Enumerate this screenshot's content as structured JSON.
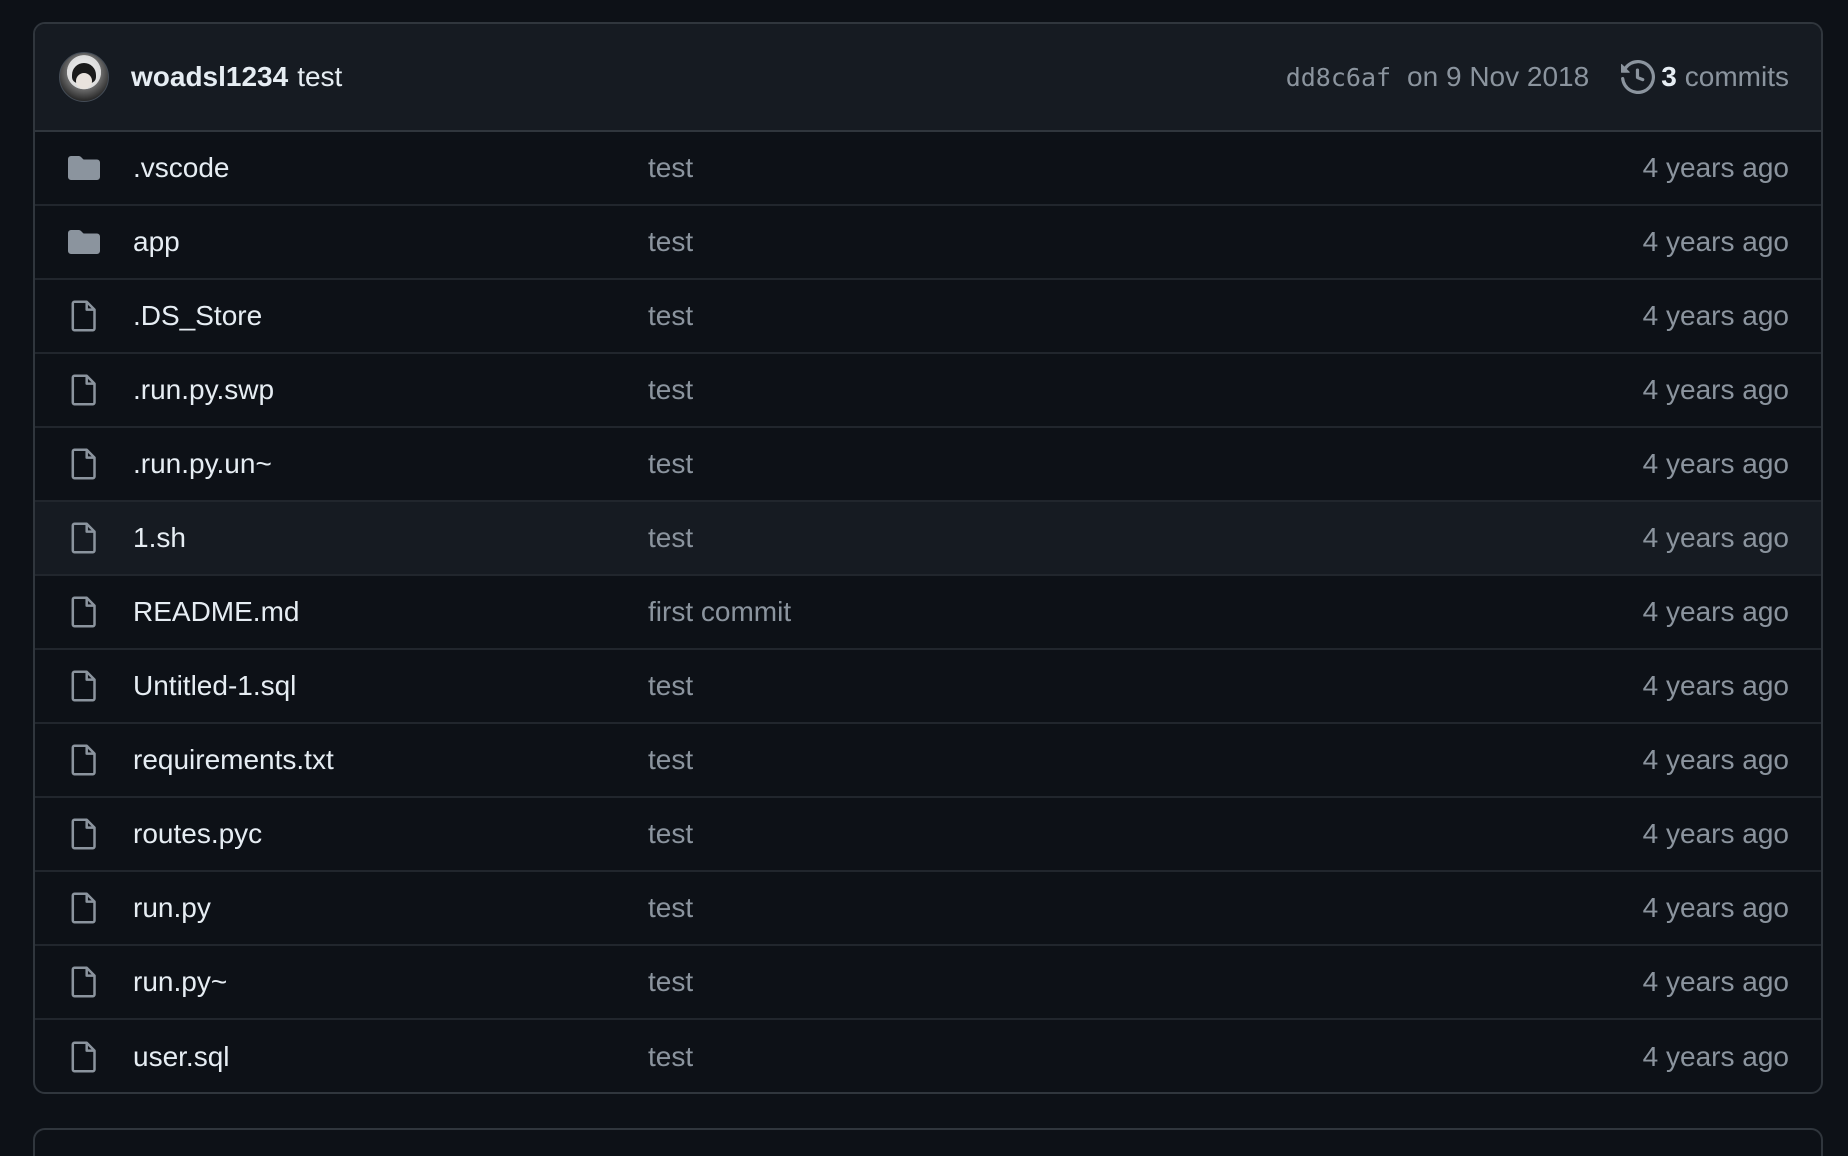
{
  "commit": {
    "author": "woadsl1234",
    "message": "test",
    "sha": "dd8c6af",
    "date": "on 9 Nov 2018",
    "commit_count": "3",
    "commits_label": "commits"
  },
  "files": [
    {
      "name": ".vscode",
      "type": "folder",
      "message": "test",
      "age": "4 years ago"
    },
    {
      "name": "app",
      "type": "folder",
      "message": "test",
      "age": "4 years ago"
    },
    {
      "name": ".DS_Store",
      "type": "file",
      "message": "test",
      "age": "4 years ago"
    },
    {
      "name": ".run.py.swp",
      "type": "file",
      "message": "test",
      "age": "4 years ago"
    },
    {
      "name": ".run.py.un~",
      "type": "file",
      "message": "test",
      "age": "4 years ago"
    },
    {
      "name": "1.sh",
      "type": "file",
      "message": "test",
      "age": "4 years ago"
    },
    {
      "name": "README.md",
      "type": "file",
      "message": "first commit",
      "age": "4 years ago"
    },
    {
      "name": "Untitled-1.sql",
      "type": "file",
      "message": "test",
      "age": "4 years ago"
    },
    {
      "name": "requirements.txt",
      "type": "file",
      "message": "test",
      "age": "4 years ago"
    },
    {
      "name": "routes.pyc",
      "type": "file",
      "message": "test",
      "age": "4 years ago"
    },
    {
      "name": "run.py",
      "type": "file",
      "message": "test",
      "age": "4 years ago"
    },
    {
      "name": "run.py~",
      "type": "file",
      "message": "test",
      "age": "4 years ago"
    },
    {
      "name": "user.sql",
      "type": "file",
      "message": "test",
      "age": "4 years ago"
    }
  ],
  "icons": {
    "folder": "folder-icon",
    "file": "file-icon",
    "history": "history-icon"
  },
  "colors": {
    "background": "#0d1117",
    "header_bg": "#161b22",
    "border": "#30363d",
    "text": "#e6edf3",
    "muted": "#8b949e",
    "folder": "#8b949e"
  }
}
